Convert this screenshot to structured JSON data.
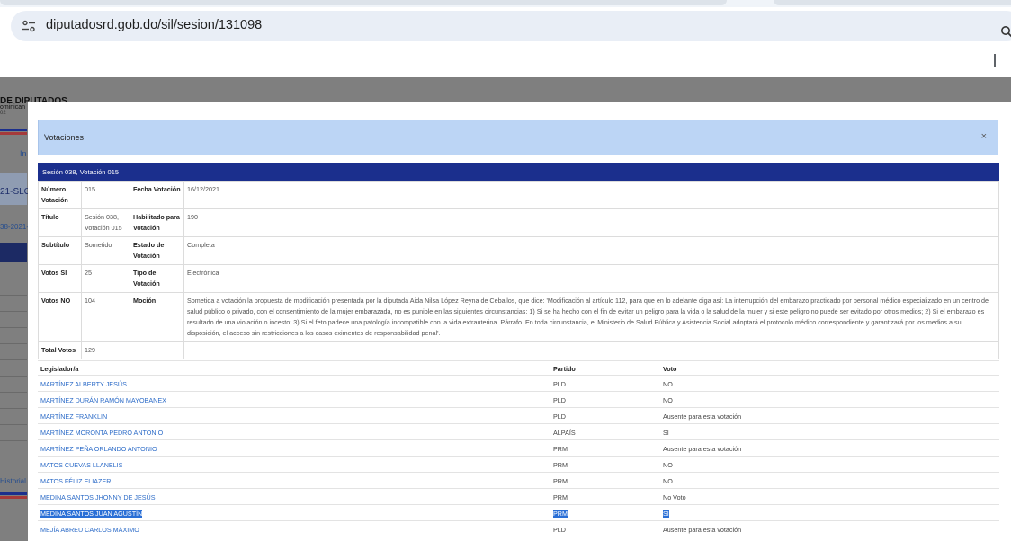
{
  "browser": {
    "url": "diputadosrd.gob.do/sil/sesion/131098"
  },
  "background": {
    "header_title": "DE DIPUTADOS",
    "header_sub": "ominican",
    "header_sub2": "02",
    "link_in": "In",
    "link_session": "21-SLO",
    "link_date": "38-2021-",
    "link_historial": "Historial"
  },
  "modal": {
    "title": "Votaciones",
    "close": "×",
    "session_bar": "Sesión 038, Votación 015",
    "details": {
      "numero_label": "Número Votación",
      "numero_value": "015",
      "fecha_label": "Fecha Votación",
      "fecha_value": "16/12/2021",
      "titulo_label": "Título",
      "titulo_value": "Sesión 038, Votación 015",
      "habilitado_label": "Habilitado para Votación",
      "habilitado_value": "190",
      "subtitulo_label": "Subtítulo",
      "subtitulo_value": "Sometido",
      "estado_label": "Estado de Votación",
      "estado_value": "Completa",
      "votos_si_label": "Votos SI",
      "votos_si_value": "25",
      "tipo_label": "Tipo de Votación",
      "tipo_value": "Electrónica",
      "votos_no_label": "Votos NO",
      "votos_no_value": "104",
      "mocion_label": "Moción",
      "mocion_value": "Sometida a votación la propuesta de modificación presentada por la diputada Aida Nilsa López Reyna de Ceballos, que dice: 'Modificación al artículo 112, para que en lo adelante diga así: La interrupción del embarazo practicado por personal médico especializado en un centro de salud público o privado, con el consentimiento de la mujer embarazada, no es punible en las siguientes circunstancias: 1) Si se ha hecho con el fin de evitar un peligro para la vida o la salud de la mujer y si este peligro no puede ser evitado por otros medios; 2) Si el embarazo es resultado de una violación o incesto; 3) Si el feto padece una patología incompatible con la vida extrauterina. Párrafo. En toda circunstancia, el Ministerio de Salud Pública y Asistencia Social adoptará el protocolo médico correspondiente y garantizará por los medios a su disposición, el acceso sin restricciones a los casos eximentes de responsabilidad penal'.",
      "total_label": "Total Votos",
      "total_value": "129"
    },
    "votes_table": {
      "headers": [
        "Legislador/a",
        "Partido",
        "Voto"
      ],
      "rows": [
        {
          "legislador": "MARTÍNEZ ALBERTY JESÚS",
          "partido": "PLD",
          "voto": "NO"
        },
        {
          "legislador": "MARTÍNEZ DURÁN RAMÓN MAYOBANEX",
          "partido": "PLD",
          "voto": "NO"
        },
        {
          "legislador": "MARTÍNEZ FRANKLIN",
          "partido": "PLD",
          "voto": "Ausente para esta votación"
        },
        {
          "legislador": "MARTÍNEZ MORONTA PEDRO ANTONIO",
          "partido": "ALPAÍS",
          "voto": "SI"
        },
        {
          "legislador": "MARTÍNEZ PEÑA ORLANDO ANTONIO",
          "partido": "PRM",
          "voto": "Ausente para esta votación"
        },
        {
          "legislador": "MATOS CUEVAS LLANELIS",
          "partido": "PRM",
          "voto": "NO"
        },
        {
          "legislador": "MATOS FÉLIZ ELIAZER",
          "partido": "PRM",
          "voto": "NO"
        },
        {
          "legislador": "MEDINA SANTOS JHONNY DE JESÚS",
          "partido": "PRM",
          "voto": "No Voto"
        },
        {
          "legislador": "MEDINA SANTOS JUAN AGUSTÍN",
          "partido": "PRM",
          "voto": "SI"
        },
        {
          "legislador": "MEJÍA ABREU CARLOS MÁXIMO",
          "partido": "PLD",
          "voto": "Ausente para esta votación"
        }
      ]
    }
  },
  "colors": {
    "session_bar": "#1b2f8d",
    "modal_header": "#bcd5f5",
    "link": "#2d6cc8",
    "selection": "#2a6fd6"
  },
  "icons": [
    "site-info-icon",
    "search-icon"
  ]
}
